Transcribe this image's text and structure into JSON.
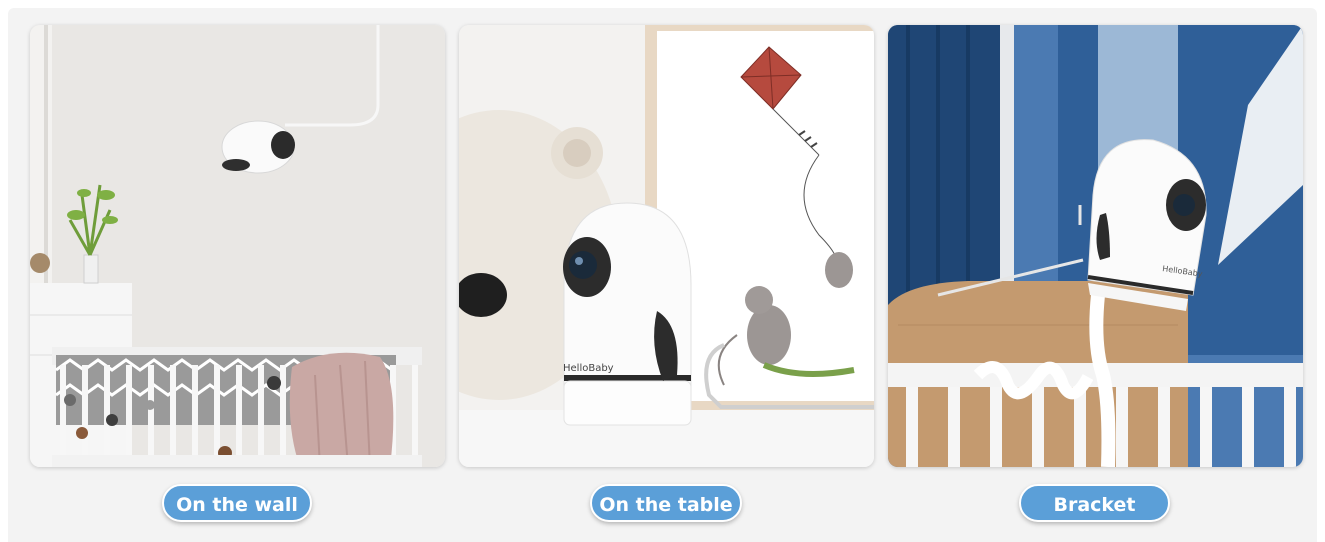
{
  "mounts": [
    {
      "label": "On the wall",
      "scene": "wall-mounted camera above crib"
    },
    {
      "label": "On the table",
      "scene": "camera on table next to teddy bear and framed kite print",
      "brand_text": "HelloBaby"
    },
    {
      "label": "Bracket",
      "scene": "camera on bracket attached to crib rail",
      "brand_text": "HelloBaby"
    }
  ],
  "colors": {
    "pill_background": "#5b9fd8",
    "pill_text": "#ffffff",
    "page_background": "#f3f3f3"
  }
}
